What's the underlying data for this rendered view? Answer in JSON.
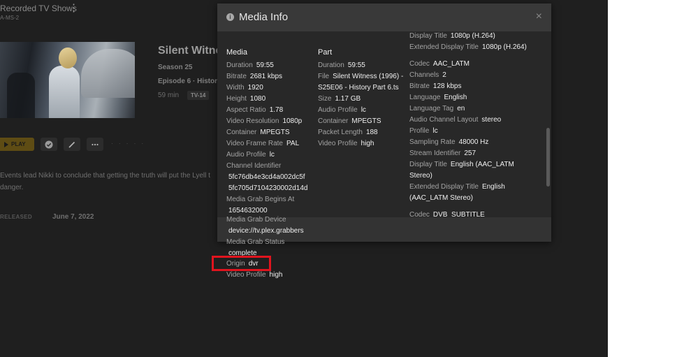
{
  "background": {
    "library": {
      "title": "Recorded TV Shows",
      "subtitle": "A-MS-2",
      "menu_icon": "kebab-menu-icon"
    },
    "show": {
      "title": "Silent Witne",
      "season": "Season 25",
      "episode": "Episode 6 · History",
      "duration": "59 min",
      "rating": "TV-14"
    },
    "actions": {
      "play_label": "PLAY",
      "dots": "· · · · ·"
    },
    "summary": {
      "line1": "Events lead Nikki to conclude that getting the truth will put the Lyell t",
      "line2": "danger."
    },
    "released": {
      "label": "RELEASED",
      "value": "June 7, 2022"
    }
  },
  "modal": {
    "title": "Media Info",
    "close_glyph": "×",
    "media": {
      "heading": "Media",
      "rows": [
        {
          "label": "Duration",
          "value": "59:55"
        },
        {
          "label": "Bitrate",
          "value": "2681 kbps"
        },
        {
          "label": "Width",
          "value": "1920"
        },
        {
          "label": "Height",
          "value": "1080"
        },
        {
          "label": "Aspect Ratio",
          "value": "1.78"
        },
        {
          "label": "Video Resolution",
          "value": "1080p"
        },
        {
          "label": "Container",
          "value": "MPEGTS"
        },
        {
          "label": "Video Frame Rate",
          "value": "PAL"
        },
        {
          "label": "Audio Profile",
          "value": "lc"
        },
        {
          "label": "Channel Identifier",
          "value": ""
        },
        {
          "label": "",
          "value": "5fc76db4e3cd4a002dc5f"
        },
        {
          "label": "",
          "value": "5fc705d7104230002d14d"
        },
        {
          "label": "Media Grab Begins At",
          "value": ""
        },
        {
          "label": "",
          "value": "1654632000"
        }
      ],
      "overflow_rows": [
        {
          "label": "Media Grab Device",
          "value": ""
        },
        {
          "label": "",
          "value": "device://tv.plex.grabbers"
        },
        {
          "label": "Media Grab Status",
          "value": ""
        },
        {
          "label": "",
          "value": "complete"
        },
        {
          "label": "Origin",
          "value": "dvr"
        },
        {
          "label": "Video Profile",
          "value": "high"
        }
      ]
    },
    "part": {
      "heading": "Part",
      "rows": [
        {
          "label": "Duration",
          "value": "59:55"
        },
        {
          "label": "File",
          "value": "Silent Witness (1996) -"
        },
        {
          "label": "",
          "value": "S25E06 - History Part 6.ts"
        },
        {
          "label": "Size",
          "value": "1.17 GB"
        },
        {
          "label": "Audio Profile",
          "value": "lc"
        },
        {
          "label": "Container",
          "value": "MPEGTS"
        },
        {
          "label": "Packet Length",
          "value": "188"
        },
        {
          "label": "Video Profile",
          "value": "high"
        }
      ]
    },
    "streams": {
      "rows": [
        {
          "label": "Display Title",
          "value": "1080p (H.264)"
        },
        {
          "label": "Extended Display Title",
          "value": "1080p (H.264)"
        },
        {
          "label": "Codec",
          "value": "AAC_LATM"
        },
        {
          "label": "Channels",
          "value": "2"
        },
        {
          "label": "Bitrate",
          "value": "128 kbps"
        },
        {
          "label": "Language",
          "value": "English"
        },
        {
          "label": "Language Tag",
          "value": "en"
        },
        {
          "label": "Audio Channel Layout",
          "value": "stereo"
        },
        {
          "label": "Profile",
          "value": "lc"
        },
        {
          "label": "Sampling Rate",
          "value": "48000 Hz"
        },
        {
          "label": "Stream Identifier",
          "value": "257"
        },
        {
          "label": "Display Title",
          "value": "English (AAC_LATM"
        },
        {
          "label": "",
          "value": "Stereo)"
        },
        {
          "label": "Extended Display Title",
          "value": "English"
        },
        {
          "label": "",
          "value": "(AAC_LATM Stereo)"
        },
        {
          "label": "Codec",
          "value": "DVB_SUBTITLE"
        }
      ]
    }
  },
  "highlight": {
    "target": "Origin",
    "color": "#e0141e"
  },
  "colors": {
    "background": "#1f1f1f",
    "modal": "#282828",
    "modal_header": "#393939",
    "accent": "#e5a00d"
  }
}
